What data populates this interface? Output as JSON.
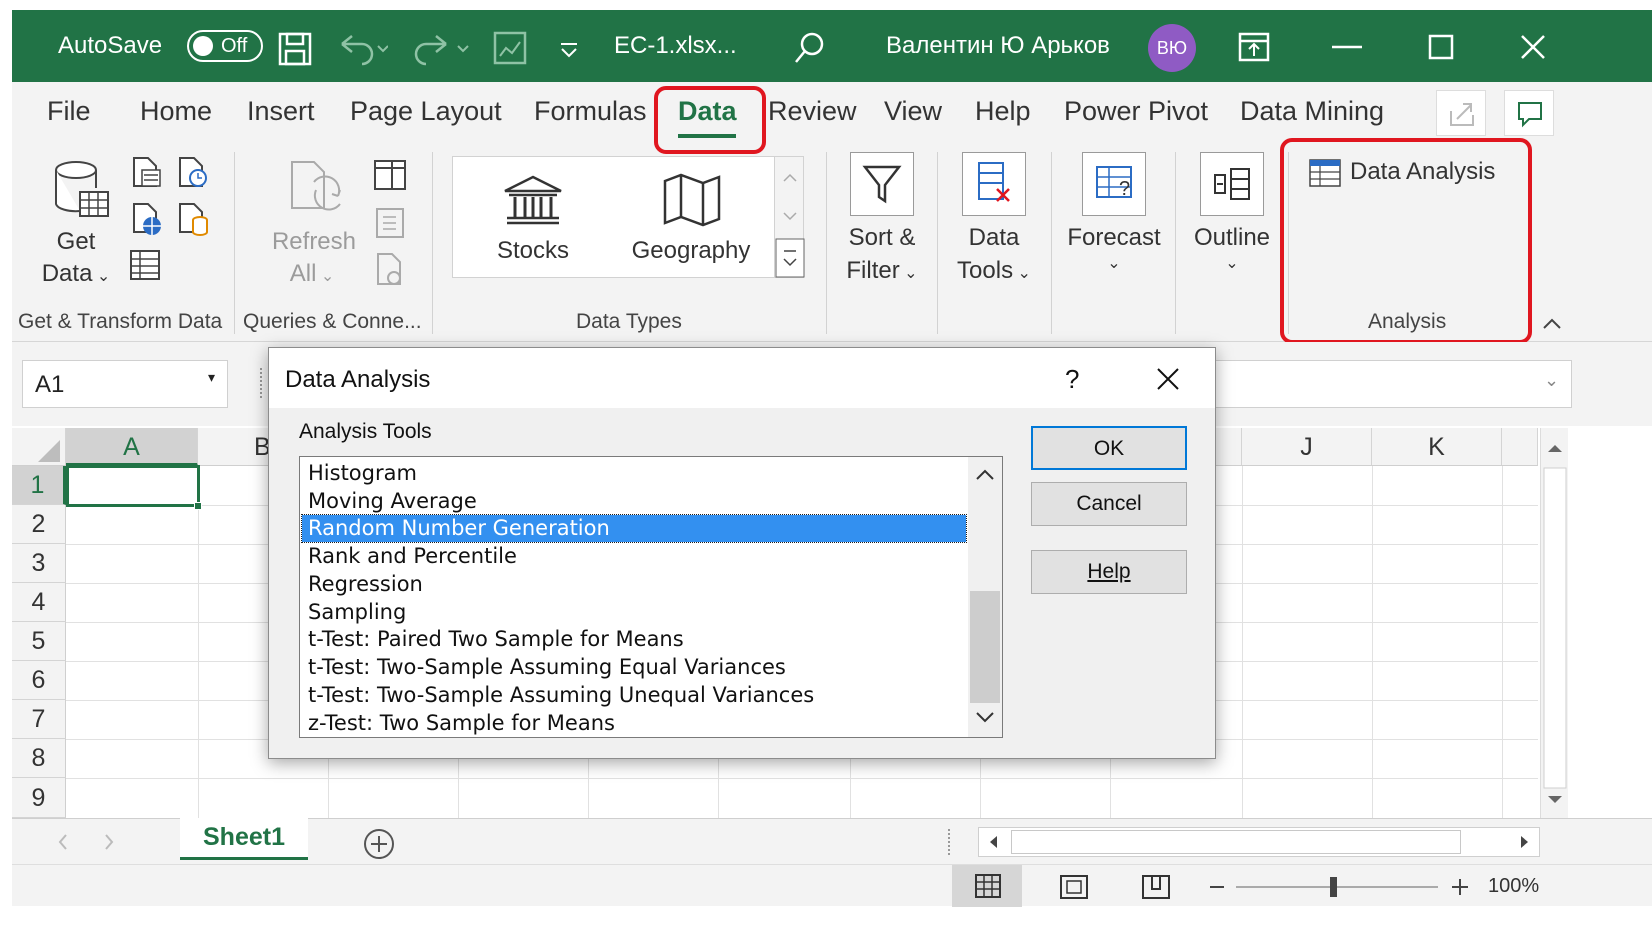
{
  "titlebar": {
    "autosave_label": "AutoSave",
    "autosave_state": "Off",
    "filename": "EC-1.xlsx...",
    "user_name": "Валентин Ю Арьков",
    "user_initials": "ВЮ"
  },
  "tabs": [
    "File",
    "Home",
    "Insert",
    "Page Layout",
    "Formulas",
    "Data",
    "Review",
    "View",
    "Help",
    "Power Pivot",
    "Data Mining"
  ],
  "active_tab": "Data",
  "ribbon": {
    "get_data_line1": "Get",
    "get_data_line2": "Data",
    "refresh_line1": "Refresh",
    "refresh_line2": "All",
    "stocks": "Stocks",
    "geography": "Geography",
    "sort_line1": "Sort &",
    "sort_line2": "Filter",
    "datatools_line1": "Data",
    "datatools_line2": "Tools",
    "forecast": "Forecast",
    "outline": "Outline",
    "data_analysis": "Data Analysis",
    "groups": {
      "get_transform": "Get & Transform Data",
      "queries": "Queries & Conne...",
      "data_types": "Data Types",
      "analysis": "Analysis"
    }
  },
  "namebox": "A1",
  "columns": [
    "A",
    "B",
    "J",
    "K"
  ],
  "rows": [
    "1",
    "2",
    "3",
    "4",
    "5",
    "6",
    "7",
    "8",
    "9"
  ],
  "sheet_tab": "Sheet1",
  "zoom": "100%",
  "dialog": {
    "title": "Data Analysis",
    "help_glyph": "?",
    "list_label": "Analysis Tools",
    "items": [
      "Histogram",
      "Moving Average",
      "Random Number Generation",
      "Rank and Percentile",
      "Regression",
      "Sampling",
      "t-Test: Paired Two Sample for Means",
      "t-Test: Two-Sample Assuming Equal Variances",
      "t-Test: Two-Sample Assuming Unequal Variances",
      "z-Test: Two Sample for Means"
    ],
    "selected_item": "Random Number Generation",
    "ok": "OK",
    "cancel": "Cancel",
    "help": "Help"
  },
  "colors": {
    "excel_green": "#217346",
    "highlight_red": "#e0161f",
    "selection_blue": "#3390f0"
  }
}
